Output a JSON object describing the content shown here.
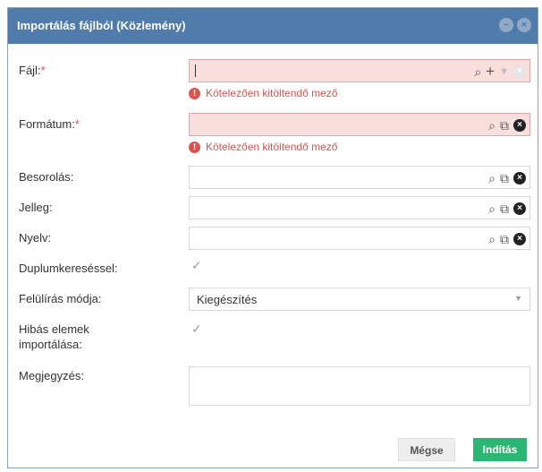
{
  "dialog": {
    "title": "Importálás fájlból (Közlemény)",
    "fields": {
      "file": {
        "label": "Fájl:",
        "required_mark": "*",
        "error": "Kötelezően kitöltendő mező"
      },
      "format": {
        "label": "Formátum:",
        "required_mark": "*",
        "error": "Kötelezően kitöltendő mező"
      },
      "classification": {
        "label": "Besorolás:"
      },
      "character": {
        "label": "Jelleg:"
      },
      "language": {
        "label": "Nyelv:"
      },
      "duplicate_search": {
        "label": "Duplumkereséssel:",
        "checked": true
      },
      "overwrite_mode": {
        "label": "Felülírás módja:",
        "value": "Kiegészítés"
      },
      "import_faulty_line1": {
        "label": "Hibás elemek"
      },
      "import_faulty_line2": {
        "label": "importálása:",
        "checked": true
      },
      "note": {
        "label": "Megjegyzés:"
      }
    },
    "buttons": {
      "cancel": "Mégse",
      "start": "Indítás"
    }
  },
  "colors": {
    "titlebar": "#4f7cab",
    "error": "#d9534f",
    "error_field_bg": "#f9dede",
    "start_button": "#2bb673"
  },
  "icons": {
    "search": "search-icon",
    "add": "plus-icon",
    "dropdown": "chevron-down-icon",
    "open": "open-external-icon",
    "clear": "clear-icon",
    "error": "error-icon",
    "check": "check-icon"
  }
}
